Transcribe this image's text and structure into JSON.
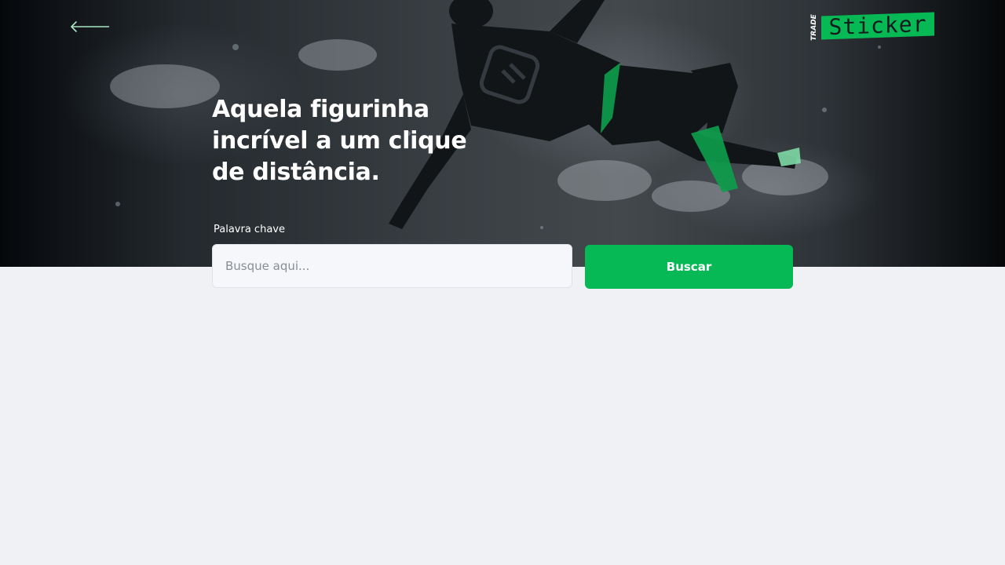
{
  "header": {
    "back_icon": "arrow-left-icon",
    "logo": {
      "small_text": "TRADE",
      "main_text": "Sticker",
      "accent_color": "#06b955"
    }
  },
  "hero": {
    "headline": "Aquela figurinha\nincrível a um clique\nde distância.",
    "image_subject": "football-player-bicycle-kick"
  },
  "search": {
    "label": "Palavra chave",
    "placeholder": "Busque aqui...",
    "value": "",
    "button_label": "Buscar",
    "button_color": "#06b955"
  }
}
